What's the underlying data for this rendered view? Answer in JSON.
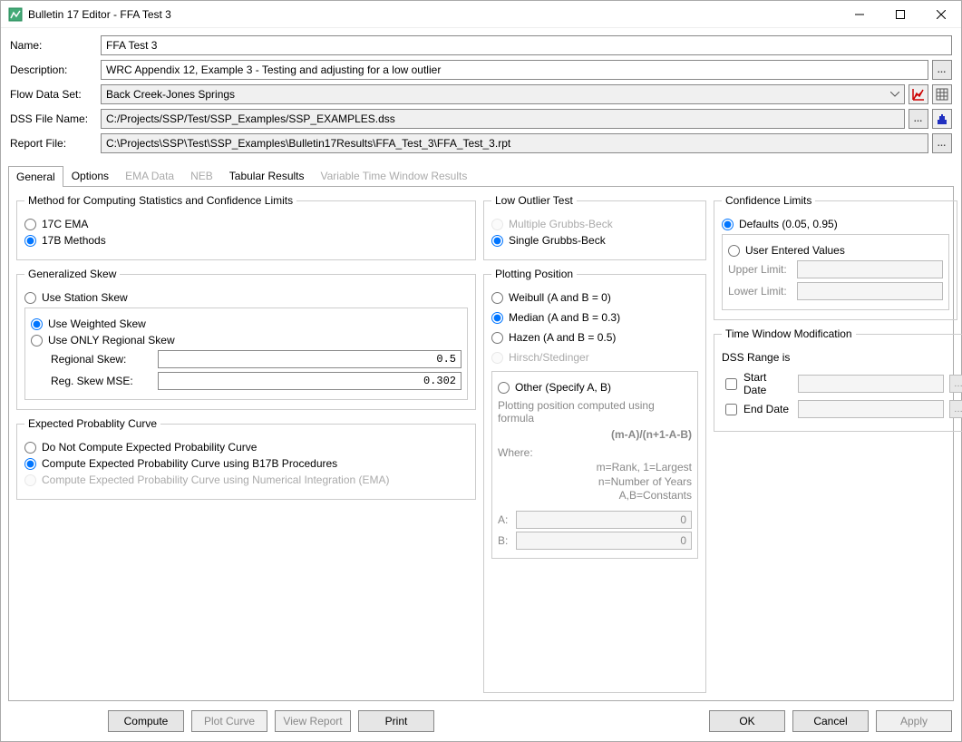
{
  "window": {
    "title": "Bulletin 17 Editor - FFA Test 3"
  },
  "form": {
    "name_label": "Name:",
    "name": "FFA Test 3",
    "desc_label": "Description:",
    "desc": "WRC Appendix 12, Example 3 - Testing and adjusting for a low outlier",
    "flow_label": "Flow Data Set:",
    "flow": "Back Creek-Jones Springs",
    "dss_label": "DSS File Name:",
    "dss": "C:/Projects/SSP/Test/SSP_Examples/SSP_EXAMPLES.dss",
    "report_label": "Report File:",
    "report": "C:\\Projects\\SSP\\Test\\SSP_Examples\\Bulletin17Results\\FFA_Test_3\\FFA_Test_3.rpt"
  },
  "tabs": {
    "general": "General",
    "options": "Options",
    "ema": "EMA Data",
    "neb": "NEB",
    "tabular": "Tabular Results",
    "vtw": "Variable Time Window Results"
  },
  "method": {
    "legend": "Method for Computing Statistics and Confidence Limits",
    "ema": "17C EMA",
    "b17b": "17B Methods"
  },
  "skew": {
    "legend": "Generalized Skew",
    "station": "Use Station Skew",
    "weighted": "Use Weighted Skew",
    "regional": "Use ONLY Regional Skew",
    "reg_label": "Regional Skew:",
    "reg_val": "0.5",
    "mse_label": "Reg. Skew MSE:",
    "mse_val": "0.302"
  },
  "prob": {
    "legend": "Expected Probablity Curve",
    "none": "Do Not Compute Expected Probability Curve",
    "b17b": "Compute Expected Probability Curve using B17B Procedures",
    "ema": "Compute Expected Probability Curve using Numerical Integration (EMA)"
  },
  "outlier": {
    "legend": "Low Outlier Test",
    "mgb": "Multiple Grubbs-Beck",
    "sgb": "Single Grubbs-Beck"
  },
  "plot": {
    "legend": "Plotting Position",
    "weibull": "Weibull (A and B = 0)",
    "median": "Median (A and B = 0.3)",
    "hazen": "Hazen (A and B = 0.5)",
    "hirsch": "Hirsch/Stedinger",
    "other": "Other (Specify A, B)",
    "help1": "Plotting position computed using formula",
    "formula": "(m-A)/(n+1-A-B)",
    "where": "Where:",
    "def1": "m=Rank, 1=Largest",
    "def2": "n=Number of Years",
    "def3": "A,B=Constants",
    "a_label": "A:",
    "a_val": "0",
    "b_label": "B:",
    "b_val": "0"
  },
  "conf": {
    "legend": "Confidence Limits",
    "defaults": "Defaults (0.05, 0.95)",
    "user": "User Entered Values",
    "upper": "Upper Limit:",
    "lower": "Lower Limit:"
  },
  "time": {
    "legend": "Time Window Modification",
    "range": "DSS Range is",
    "start": "Start Date",
    "end": "End Date"
  },
  "buttons": {
    "compute": "Compute",
    "plot": "Plot Curve",
    "view": "View Report",
    "print": "Print",
    "ok": "OK",
    "cancel": "Cancel",
    "apply": "Apply"
  }
}
